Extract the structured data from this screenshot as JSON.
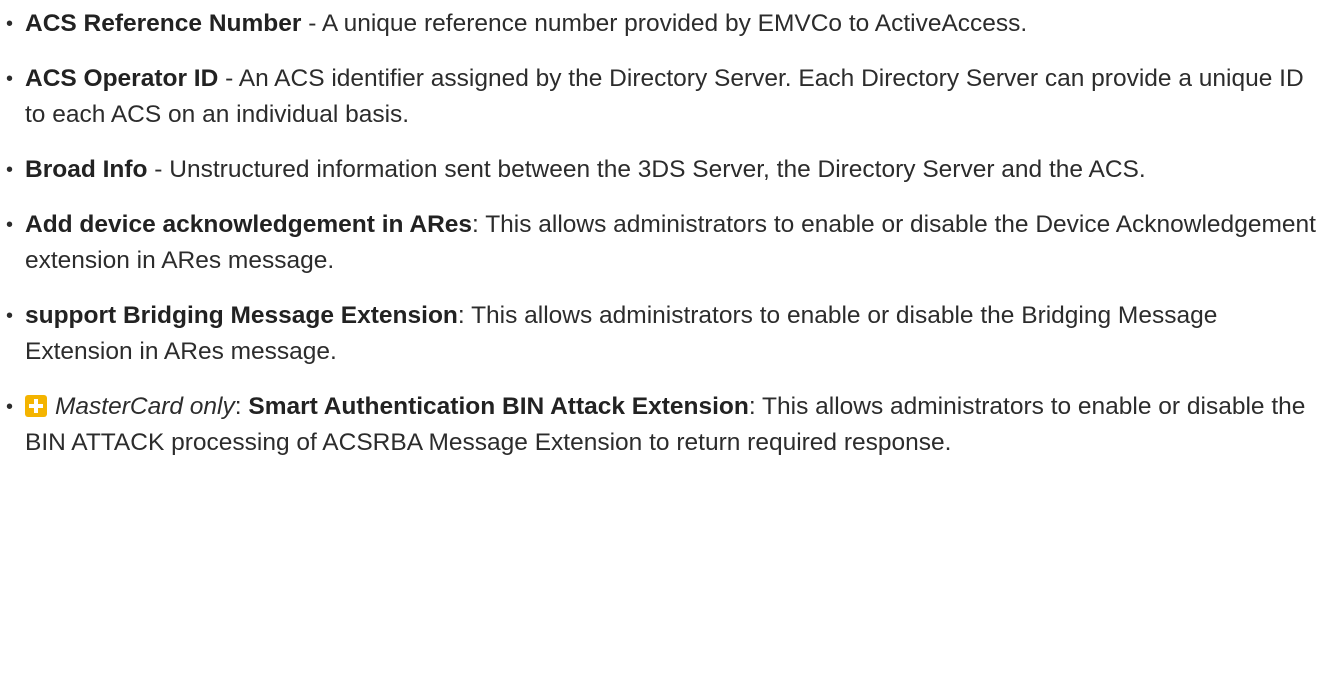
{
  "items": [
    {
      "term": "ACS Reference Number",
      "separator": " - ",
      "text": "A unique reference number provided by EMVCo to ActiveAccess."
    },
    {
      "term": "ACS Operator ID",
      "separator": " - ",
      "text": "An ACS identifier assigned by the Directory Server. Each Directory Server can provide a unique ID to each ACS on an individual basis."
    },
    {
      "term": "Broad Info",
      "separator": " - ",
      "text": "Unstructured information sent between the 3DS Server, the Directory Server and the ACS."
    },
    {
      "term": "Add device acknowledgement in ARes",
      "separator": ": ",
      "text": "This allows administrators to enable or disable the Device Acknowledgement extension in ARes message."
    },
    {
      "term": "support Bridging Message Extension",
      "separator": ": ",
      "text": "This allows administrators to enable or disable the Bridging Message Extension in ARes message."
    },
    {
      "icon": "plus-icon",
      "qualifier": "MasterCard only",
      "qualifier_separator": ": ",
      "term": "Smart Authentication BIN Attack Extension",
      "separator": ": ",
      "text": "This allows administrators to enable or disable the BIN ATTACK processing of ACSRBA Message Extension to return required response."
    }
  ],
  "bullet_glyph": "•",
  "colors": {
    "text": "#2c2c2c",
    "icon_bg": "#f4b400"
  }
}
